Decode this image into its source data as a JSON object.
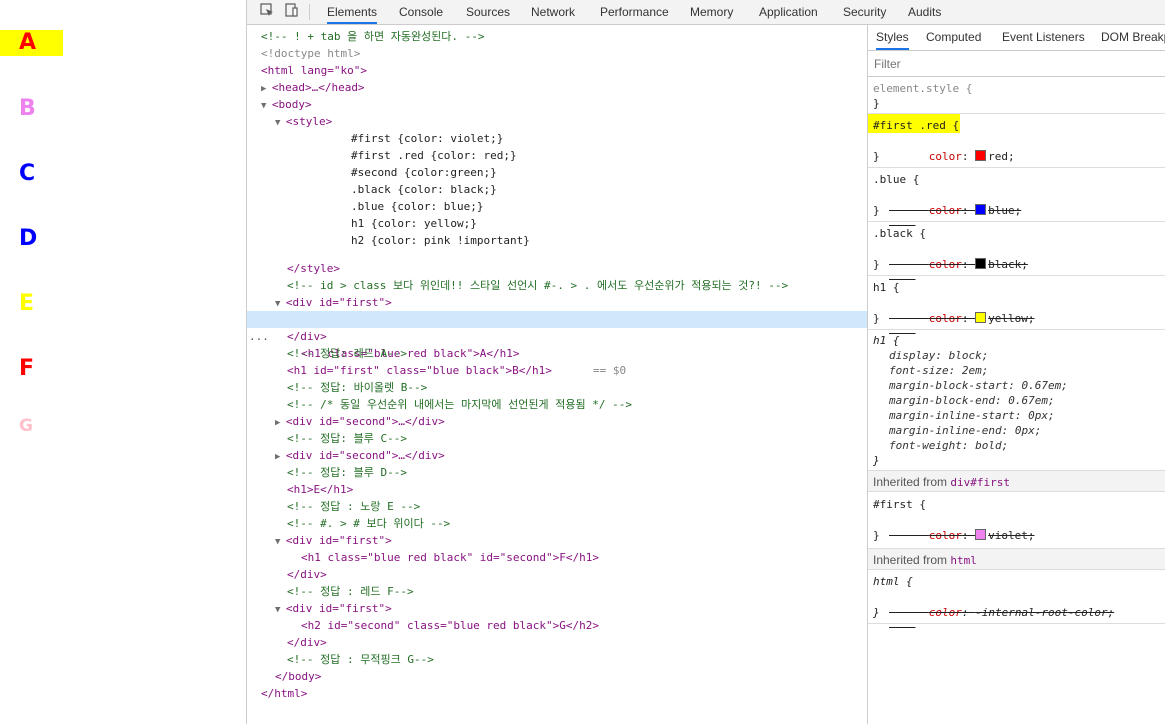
{
  "page": {
    "letters": [
      {
        "text": "A",
        "color": "#ff0000",
        "highlight": true
      },
      {
        "text": "B",
        "color": "#ee82ee"
      },
      {
        "text": "C",
        "color": "#0000ff"
      },
      {
        "text": "D",
        "color": "#0000ff"
      },
      {
        "text": "E",
        "color": "#ffff00"
      },
      {
        "text": "F",
        "color": "#ff0000"
      },
      {
        "text": "G",
        "color": "#ffc0cb"
      }
    ]
  },
  "devtools": {
    "tabs": [
      "Elements",
      "Console",
      "Sources",
      "Network",
      "Performance",
      "Memory",
      "Application",
      "Security",
      "Audits"
    ],
    "active_tab": "Elements",
    "selected_suffix": "== $0",
    "ellipsis": "...",
    "elements": [
      "<!-- ! + tab 을 하면 자동완성된다. -->",
      "<!doctype html>",
      "<html lang=\"ko\">",
      "<head>…</head>",
      "<body>",
      "<style>",
      "#first {color: violet;}",
      "#first .red {color: red;}",
      "#second {color:green;}",
      ".black {color: black;}",
      ".blue {color: blue;}",
      "h1 {color: yellow;}",
      "h2 {color: pink !important}",
      "</style>",
      "<!-- id > class 보다 위인데!! 스타일 선언시 #-. > . 에서도 우선순위가 적용되는 것?! -->",
      "<div id=\"first\">",
      "<h1 class=\"blue red black\">A</h1>",
      "</div>",
      "<!-- 정답: 레드 A-->",
      "<h1 id=\"first\" class=\"blue black\">B</h1>",
      "<!-- 정답: 바이올렛 B-->",
      "<!-- /* 동일 우선순위 내에서는 마지막에 선언된게 적용됨 */ -->",
      "<div id=\"second\">…</div>",
      "<!-- 정답: 블루 C-->",
      "<div id=\"second\">…</div>",
      "<!-- 정답: 블루 D-->",
      "<h1>E</h1>",
      "<!-- 정답 : 노랑 E -->",
      "<!-- #. > # 보다 위이다 -->",
      "<div id=\"first\">",
      "<h1 class=\"blue red black\" id=\"second\">F</h1>",
      "</div>",
      "<!-- 정답 : 레드 F-->",
      "<div id=\"first\">",
      "<h2 id=\"second\" class=\"blue red black\">G</h2>",
      "</div>",
      "<!-- 정답 : 무적핑크 G-->",
      "</body>",
      "</html>"
    ],
    "styles": {
      "tabs": [
        "Styles",
        "Computed",
        "Event Listeners",
        "DOM Breakpoints"
      ],
      "active_tab": "Styles",
      "filter_placeholder": "Filter",
      "element_style": "element.style {",
      "close_brace": "}",
      "rules": [
        {
          "selector": "#first .red {",
          "prop": "color",
          "value": "red;",
          "swatch": "#ff0000",
          "struck": false
        },
        {
          "selector": ".blue {",
          "prop": "color",
          "value": "blue;",
          "swatch": "#0000ff",
          "struck": true
        },
        {
          "selector": ".black {",
          "prop": "color",
          "value": "black;",
          "swatch": "#000000",
          "struck": true
        },
        {
          "selector": "h1 {",
          "prop": "color",
          "value": "yellow;",
          "swatch": "#ffff00",
          "struck": true
        }
      ],
      "ua_selector": "h1 {",
      "ua_props": [
        "display: block;",
        "font-size: 2em;",
        "margin-block-start: 0.67em;",
        "margin-block-end: 0.67em;",
        "margin-inline-start: 0px;",
        "margin-inline-end: 0px;",
        "font-weight: bold;"
      ],
      "inherited_first_label": "Inherited from",
      "inherited_first_tag": "div#first",
      "first_rule": {
        "selector": "#first {",
        "prop": "color",
        "value": "violet;",
        "swatch": "#ee82ee"
      },
      "inherited_html_label": "Inherited from",
      "inherited_html_tag": "html",
      "html_rule": {
        "selector": "html {",
        "prop": "color",
        "value": "-internal-root-color;"
      }
    }
  }
}
